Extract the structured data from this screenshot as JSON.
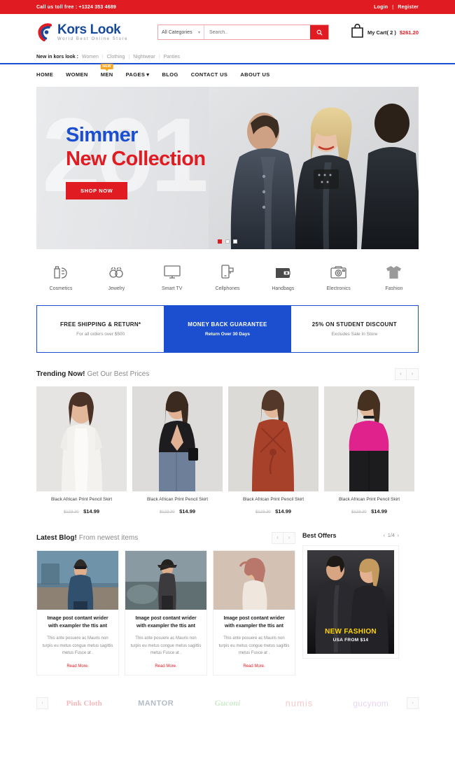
{
  "topbar": {
    "phone": "Call us toll free : +1324 353 4689",
    "login": "Login",
    "separator": "|",
    "register": "Register"
  },
  "header": {
    "logo_name": "Kors Look",
    "logo_tagline": "World Best Online Store",
    "category_select": "All Categories",
    "category_chevron": "▾",
    "search_placeholder": "Search..",
    "search_value": "",
    "search_icon": "🔍",
    "cart_label": "My Cart( 2 )",
    "cart_price": "$261.20"
  },
  "newin": {
    "label": "New in kors look :",
    "links": [
      "Women",
      "Clothing",
      "Nightwear",
      "Panties"
    ],
    "divider": "|"
  },
  "nav": {
    "items": [
      {
        "label": "HOME",
        "badge": "",
        "caret": ""
      },
      {
        "label": "WOMEN",
        "badge": "",
        "caret": ""
      },
      {
        "label": "MEN",
        "badge": "NEW",
        "caret": ""
      },
      {
        "label": "PAGES",
        "badge": "",
        "caret": "▾"
      },
      {
        "label": "BLOG",
        "badge": "",
        "caret": ""
      },
      {
        "label": "CONTACT US",
        "badge": "",
        "caret": ""
      },
      {
        "label": "ABOUT US",
        "badge": "",
        "caret": ""
      }
    ]
  },
  "hero": {
    "ghost": "201",
    "line1": "Simmer",
    "line2": "New Collection",
    "button": "SHOP NOW",
    "slides_total": 3,
    "slide_active": 1
  },
  "categories": [
    {
      "label": "Cosmetics",
      "icon": "cosmetics-icon"
    },
    {
      "label": "Jewelry",
      "icon": "jewelry-icon"
    },
    {
      "label": "Smart TV",
      "icon": "tv-icon"
    },
    {
      "label": "Cellphones",
      "icon": "cellphone-icon"
    },
    {
      "label": "Handbags",
      "icon": "handbag-icon"
    },
    {
      "label": "Electronics",
      "icon": "camera-icon"
    },
    {
      "label": "Fashion",
      "icon": "tshirt-icon"
    }
  ],
  "promos": [
    {
      "title": "FREE SHIPPING & RETURN*",
      "sub": "For all orders over $500"
    },
    {
      "title": "MONEY BACK GUARANTEE",
      "sub": "Return Over 30 Days"
    },
    {
      "title": "25% ON STUDENT DISCOUNT",
      "sub": "Excludes Sale In Store"
    }
  ],
  "trending": {
    "title": "Trending Now!",
    "subtitle": "Get Our Best Prices",
    "prev": "‹",
    "next": "›",
    "products": [
      {
        "name": "Black African Print Pencil Skirt",
        "old_price": "$123.20",
        "price": "$14.99"
      },
      {
        "name": "Black African Print Pencil Skirt",
        "old_price": "$123.20",
        "price": "$14.99"
      },
      {
        "name": "Black African Print Pencil Skirt",
        "old_price": "$123.20",
        "price": "$14.99"
      },
      {
        "name": "Black African Print Pencil Skirt",
        "old_price": "$123.20",
        "price": "$14.99"
      }
    ]
  },
  "blog": {
    "title": "Latest Blog!",
    "subtitle": "From newest items",
    "prev": "‹",
    "next": "›",
    "posts": [
      {
        "title": "Image post contant wrider with exampler the ttis ant",
        "excerpt": "This ante posuere ac Mauris non turpis eu metus congue metus sagittis metus Fusce at .",
        "more": "Read More."
      },
      {
        "title": "Image post contant wrider with exampler the ttis ant",
        "excerpt": "This ante posuere ac Mauris non turpis eu metus congue metus sagittis metus Fusce at .",
        "more": "Read More."
      },
      {
        "title": "Image post contant wrider with exampler the ttis ant",
        "excerpt": "This ante posuere ac Mauris non turpis eu metus congue metus sagittis metus Fusce at .",
        "more": "Read More."
      }
    ]
  },
  "offers": {
    "title": "Best Offers",
    "prev": "‹",
    "next": "›",
    "counter": "1/4",
    "caption_main": "NEW FASHION",
    "caption_sub": "USA FROM $14"
  },
  "brands": {
    "prev": "‹",
    "next": "›",
    "items": [
      "Pink Cloth",
      "MANTOR",
      "Guconi",
      "numis",
      "gucynom"
    ]
  },
  "colors": {
    "red": "#e01b22",
    "blue": "#1b4fd0",
    "logo_blue": "#17499c",
    "badge_orange": "#f5a623",
    "offer_yellow": "#ffd400"
  }
}
